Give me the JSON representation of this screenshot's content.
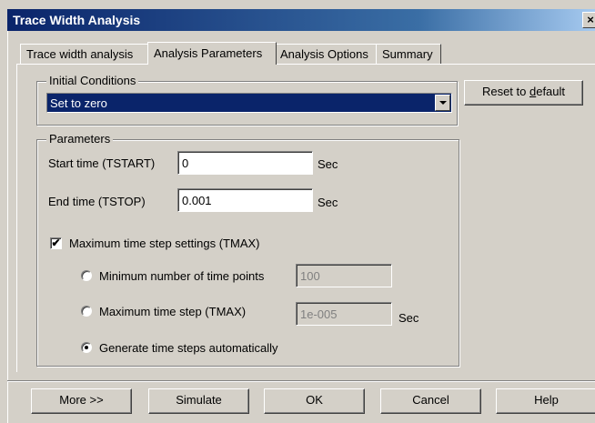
{
  "window": {
    "title": "Trace Width Analysis",
    "close_glyph": "×"
  },
  "tabs": [
    {
      "label": "Trace width analysis"
    },
    {
      "label": "Analysis Parameters"
    },
    {
      "label": "Analysis Options"
    },
    {
      "label": "Summary"
    }
  ],
  "initial_conditions": {
    "legend": "Initial Conditions",
    "selected": "Set to zero"
  },
  "reset_button": "Reset to default",
  "parameters": {
    "legend": "Parameters",
    "start_label": "Start time (TSTART)",
    "start_value": "0",
    "start_unit": "Sec",
    "end_label": "End time (TSTOP)",
    "end_value": "0.001",
    "end_unit": "Sec",
    "tmax_check_label": "Maximum time step settings (TMAX)",
    "tmax_checked": true,
    "radio_min_points_label": "Minimum number of time points",
    "min_points_value": "100",
    "radio_max_step_label": "Maximum time step (TMAX)",
    "max_step_value": "1e-005",
    "max_step_unit": "Sec",
    "radio_auto_label": "Generate time steps automatically",
    "selected_radio": "auto"
  },
  "footer": {
    "more": "More >>",
    "simulate": "Simulate",
    "ok": "OK",
    "cancel": "Cancel",
    "help": "Help"
  }
}
